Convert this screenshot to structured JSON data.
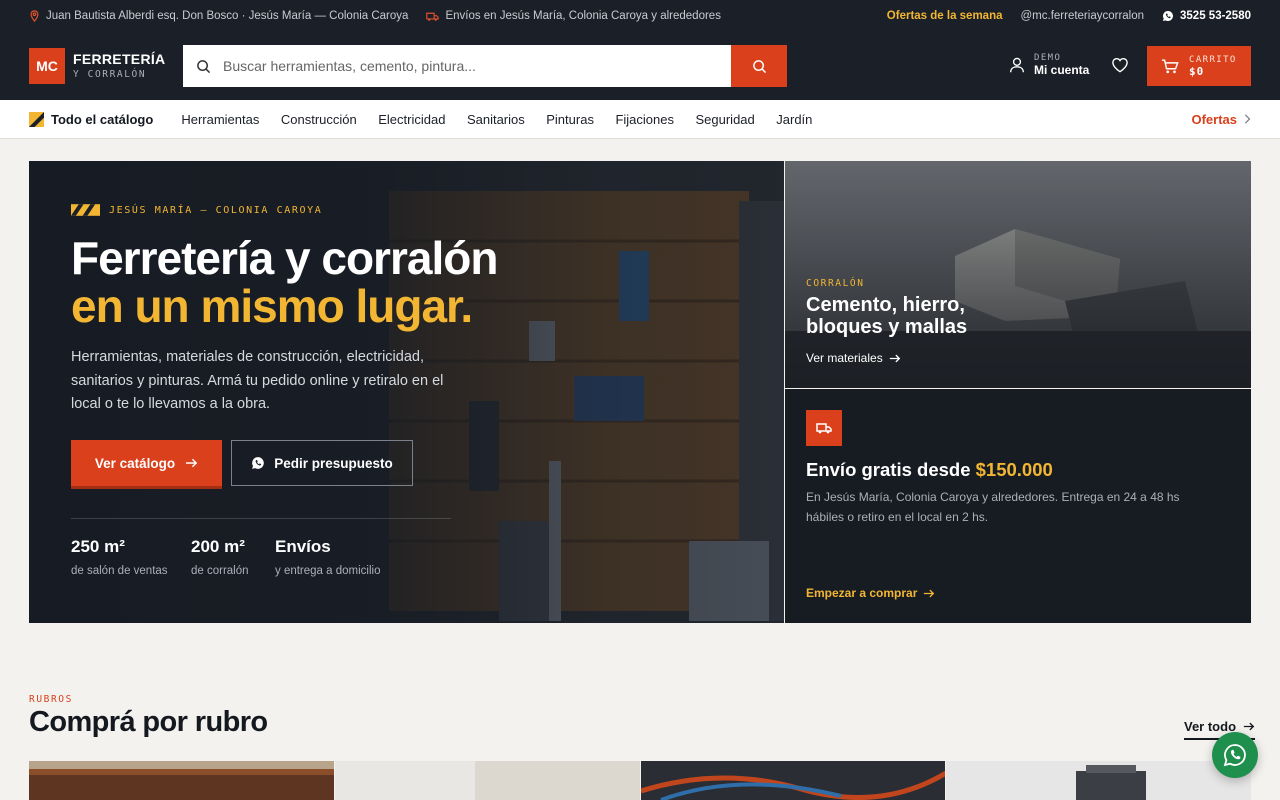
{
  "topbar": {
    "address": "Juan Bautista Alberdi esq. Don Bosco · Jesús María — Colonia Caroya",
    "shipping": "Envíos en Jesús María, Colonia Caroya y alrededores",
    "offers": "Ofertas de la semana",
    "instagram": "@mc.ferreteriaycorralon",
    "phone": "3525 53-2580"
  },
  "header": {
    "logo_badge": "MC",
    "logo_name": "FERRETERÍA",
    "logo_sub": "Y CORRALÓN",
    "search_placeholder": "Buscar herramientas, cemento, pintura...",
    "account_label": "DEMO",
    "account_name": "Mi cuenta",
    "cart_label": "CARRITO",
    "cart_total": "$0"
  },
  "nav": {
    "all_catalog": "Todo el catálogo",
    "links": [
      "Herramientas",
      "Construcción",
      "Electricidad",
      "Sanitarios",
      "Pinturas",
      "Fijaciones",
      "Seguridad",
      "Jardín"
    ],
    "offers": "Ofertas"
  },
  "hero": {
    "eyebrow": "JESÚS MARÍA — COLONIA CAROYA",
    "title_line1": "Ferretería y corralón",
    "title_line2": "en un mismo lugar.",
    "description": "Herramientas, materiales de construcción, electricidad, sanitarios y pinturas. Armá tu pedido online y retiralo en el local o te lo llevamos a la obra.",
    "primary_cta": "Ver catálogo",
    "secondary_cta": "Pedir presupuesto",
    "stats": [
      {
        "value": "250 m²",
        "label": "de salón de ventas"
      },
      {
        "value": "200 m²",
        "label": "de corralón"
      },
      {
        "value": "Envíos",
        "label": "y entrega a domicilio"
      }
    ]
  },
  "corralon_card": {
    "kicker": "CORRALÓN",
    "title": "Cemento, hierro, bloques y mallas",
    "link": "Ver materiales"
  },
  "shipping_card": {
    "title_prefix": "Envío gratis desde",
    "amount": "$150.000",
    "description": "En Jesús María, Colonia Caroya y alrededores. Entrega en 24 a 48 hs hábiles o retiro en el local en 2 hs.",
    "link": "Empezar a comprar"
  },
  "categories": {
    "kicker": "RUBROS",
    "title": "Comprá por rubro",
    "see_all": "Ver todo"
  },
  "colors": {
    "accent": "#d9401b",
    "highlight": "#f2b632",
    "dark": "#1b1f27",
    "whatsapp": "#1f8f4e"
  }
}
